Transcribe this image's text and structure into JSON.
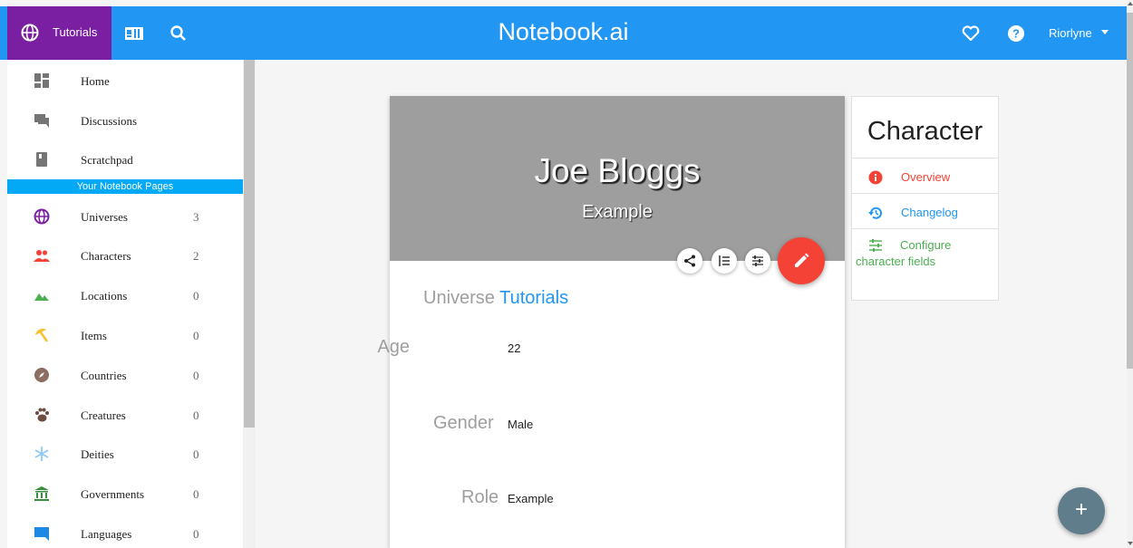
{
  "topbar": {
    "tutorials_label": "Tutorials",
    "brand": "Notebook.ai",
    "user_name": "Riorlyne"
  },
  "sidebar": {
    "top_items": [
      {
        "label": "Home",
        "icon": "dashboard-icon"
      },
      {
        "label": "Discussions",
        "icon": "forum-icon"
      },
      {
        "label": "Scratchpad",
        "icon": "book-icon"
      }
    ],
    "section_label": "Your Notebook Pages",
    "page_items": [
      {
        "label": "Universes",
        "count": "3",
        "icon": "globe-icon",
        "color": "#7b1fa2"
      },
      {
        "label": "Characters",
        "count": "2",
        "icon": "people-icon",
        "color": "#f44336"
      },
      {
        "label": "Locations",
        "count": "0",
        "icon": "terrain-icon",
        "color": "#4caf50"
      },
      {
        "label": "Items",
        "count": "0",
        "icon": "beach-icon",
        "color": "#fbc02d"
      },
      {
        "label": "Countries",
        "count": "0",
        "icon": "compass-icon",
        "color": "#8d6e63"
      },
      {
        "label": "Creatures",
        "count": "0",
        "icon": "paw-icon",
        "color": "#6d4c41"
      },
      {
        "label": "Deities",
        "count": "0",
        "icon": "snowflake-icon",
        "color": "#90caf9"
      },
      {
        "label": "Governments",
        "count": "0",
        "icon": "bank-icon",
        "color": "#388e3c"
      },
      {
        "label": "Languages",
        "count": "0",
        "icon": "chat-icon",
        "color": "#1e88e5"
      }
    ]
  },
  "card": {
    "name": "Joe Bloggs",
    "subtitle": "Example",
    "universe_label": "Universe",
    "universe_value": "Tutorials",
    "fields": [
      {
        "label": "Age",
        "value": "22"
      },
      {
        "label": "Gender",
        "value": "Male"
      },
      {
        "label": "Role",
        "value": "Example"
      }
    ]
  },
  "side_panel": {
    "title": "Character",
    "items": [
      {
        "label": "Overview",
        "color": "#f44336"
      },
      {
        "label": "Changelog",
        "color": "#2196f3"
      },
      {
        "label": "Configure character fields",
        "color": "#4caf50"
      }
    ]
  },
  "colors": {
    "primary": "#2196f3",
    "tutorials_tab": "#7b1fa2",
    "edit_fab": "#f44336",
    "add_fab": "#607d8b",
    "section": "#03a9f4"
  },
  "add_button_label": "+"
}
